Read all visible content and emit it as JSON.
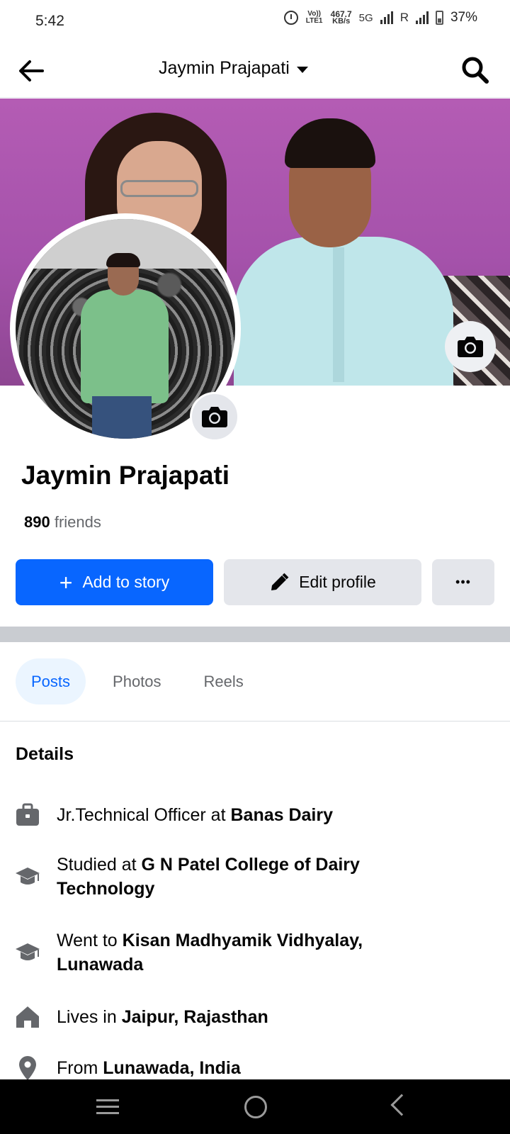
{
  "status_bar": {
    "time": "5:42",
    "volte": "Vo)) LTE1",
    "speed_value": "467.7",
    "speed_unit": "KB/s",
    "network": "5G",
    "roaming": "R",
    "battery": "37%"
  },
  "header": {
    "title": "Jaymin Prajapati"
  },
  "profile": {
    "name": "Jaymin Prajapati",
    "friends_count": "890",
    "friends_label": "friends"
  },
  "actions": {
    "add_story": "Add to story",
    "edit_profile": "Edit profile",
    "more": "•••"
  },
  "tabs": [
    {
      "label": "Posts",
      "active": true
    },
    {
      "label": "Photos",
      "active": false
    },
    {
      "label": "Reels",
      "active": false
    }
  ],
  "details": {
    "heading": "Details",
    "items": [
      {
        "icon": "briefcase-icon",
        "prefix": "Jr.Technical Officer at ",
        "bold": "Banas Dairy"
      },
      {
        "icon": "graduation-cap-icon",
        "prefix": "Studied at ",
        "bold": "G N Patel College of Dairy Technology"
      },
      {
        "icon": "graduation-cap-icon",
        "prefix": "Went to ",
        "bold": "Kisan Madhyamik Vidhyalay, Lunawada"
      },
      {
        "icon": "home-icon",
        "prefix": "Lives in ",
        "bold": "Jaipur, Rajasthan"
      },
      {
        "icon": "location-pin-icon",
        "prefix": "From ",
        "bold": "Lunawada, India"
      }
    ]
  },
  "colors": {
    "brand_blue": "#0866ff",
    "button_gray": "#e4e6eb",
    "tab_active_bg": "#ebf5ff",
    "cover_purple": "#b45cb4"
  }
}
